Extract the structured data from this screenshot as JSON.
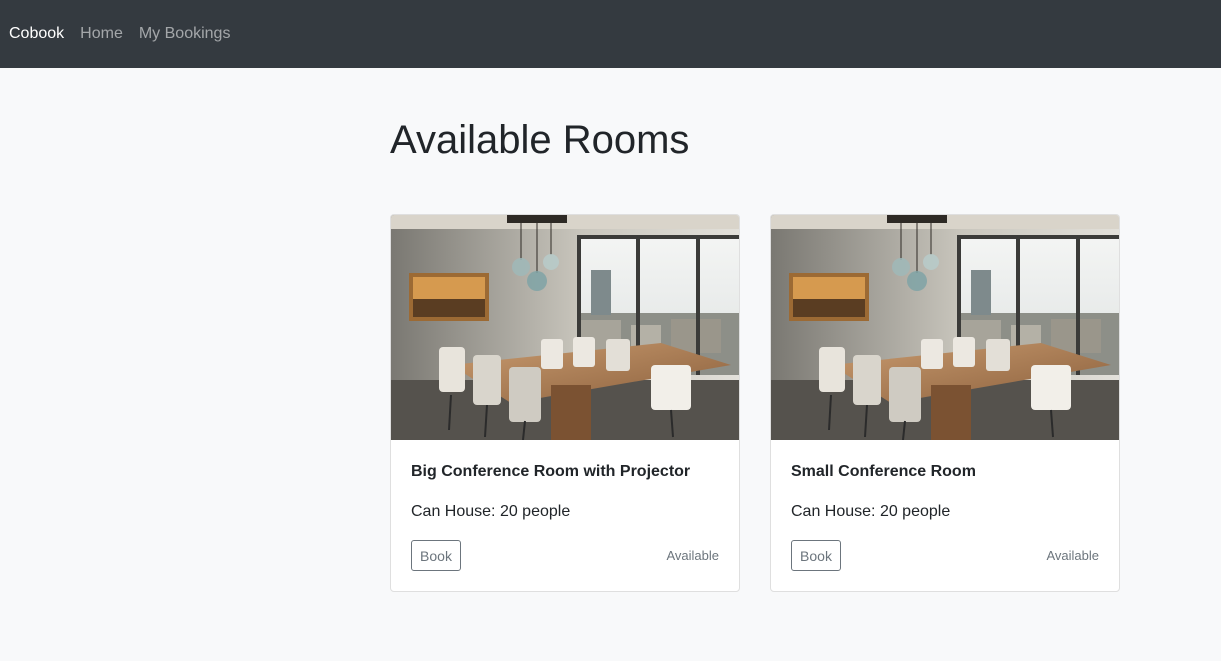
{
  "navbar": {
    "brand": "Cobook",
    "links": [
      {
        "label": "Home"
      },
      {
        "label": "My Bookings"
      }
    ]
  },
  "main": {
    "title": "Available Rooms",
    "rooms": [
      {
        "name": "Big Conference Room with Projector",
        "capacity_text": "Can House: 20 people",
        "book_label": "Book",
        "status": "Available"
      },
      {
        "name": "Small Conference Room",
        "capacity_text": "Can House: 20 people",
        "book_label": "Book",
        "status": "Available"
      }
    ]
  },
  "colors": {
    "navbar_bg": "#343a40",
    "page_bg": "#f8f9fa",
    "button_outline": "#6c757d"
  }
}
